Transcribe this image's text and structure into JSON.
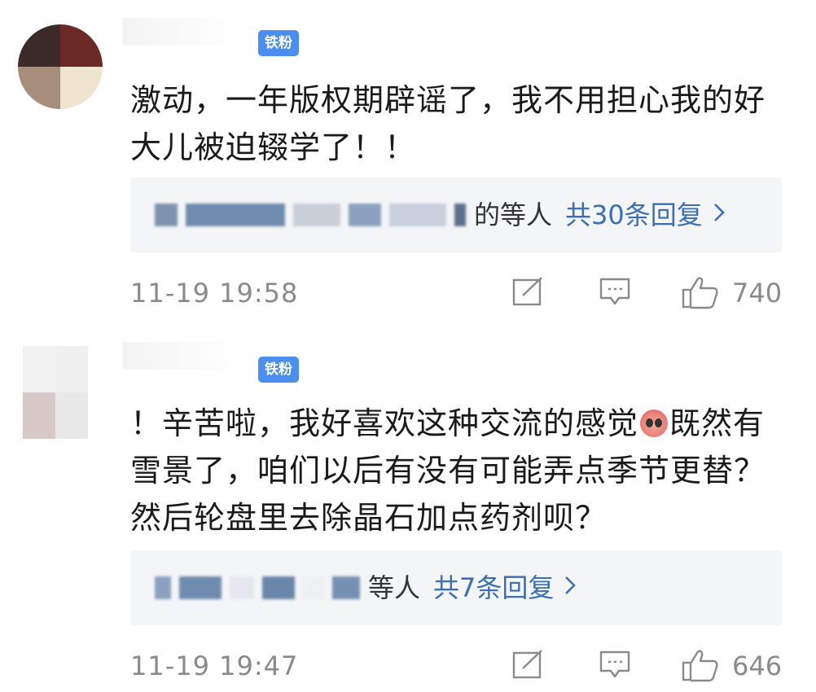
{
  "comments": [
    {
      "badge": "铁粉",
      "text": "激动，一年版权期辟谣了，我不用担心我的好大儿被迫辍学了！！",
      "reply_suffix": "的等人",
      "reply_count": "共30条回复",
      "time": "11-19 19:58",
      "likes": "740"
    },
    {
      "badge": "铁粉",
      "text_before_emoji": "！辛苦啦，我好喜欢这种交流的感觉",
      "emoji": "crying-face-emoji",
      "text_after_emoji": "既然有雪景了，咱们以后有没有可能弄点季节更替？然后轮盘里去除晶石加点药剂呗？",
      "reply_suffix": "等人",
      "reply_count": "共7条回复",
      "time": "11-19 19:47",
      "likes": "646"
    }
  ],
  "icons": [
    "edit-icon",
    "comment-icon",
    "like-icon",
    "chevron-right-icon"
  ],
  "colors": {
    "badge_bg": "#4a8ff0",
    "link": "#3b6fb5",
    "reply_bg": "#f4f5f7",
    "meta": "#8a8a8a"
  }
}
